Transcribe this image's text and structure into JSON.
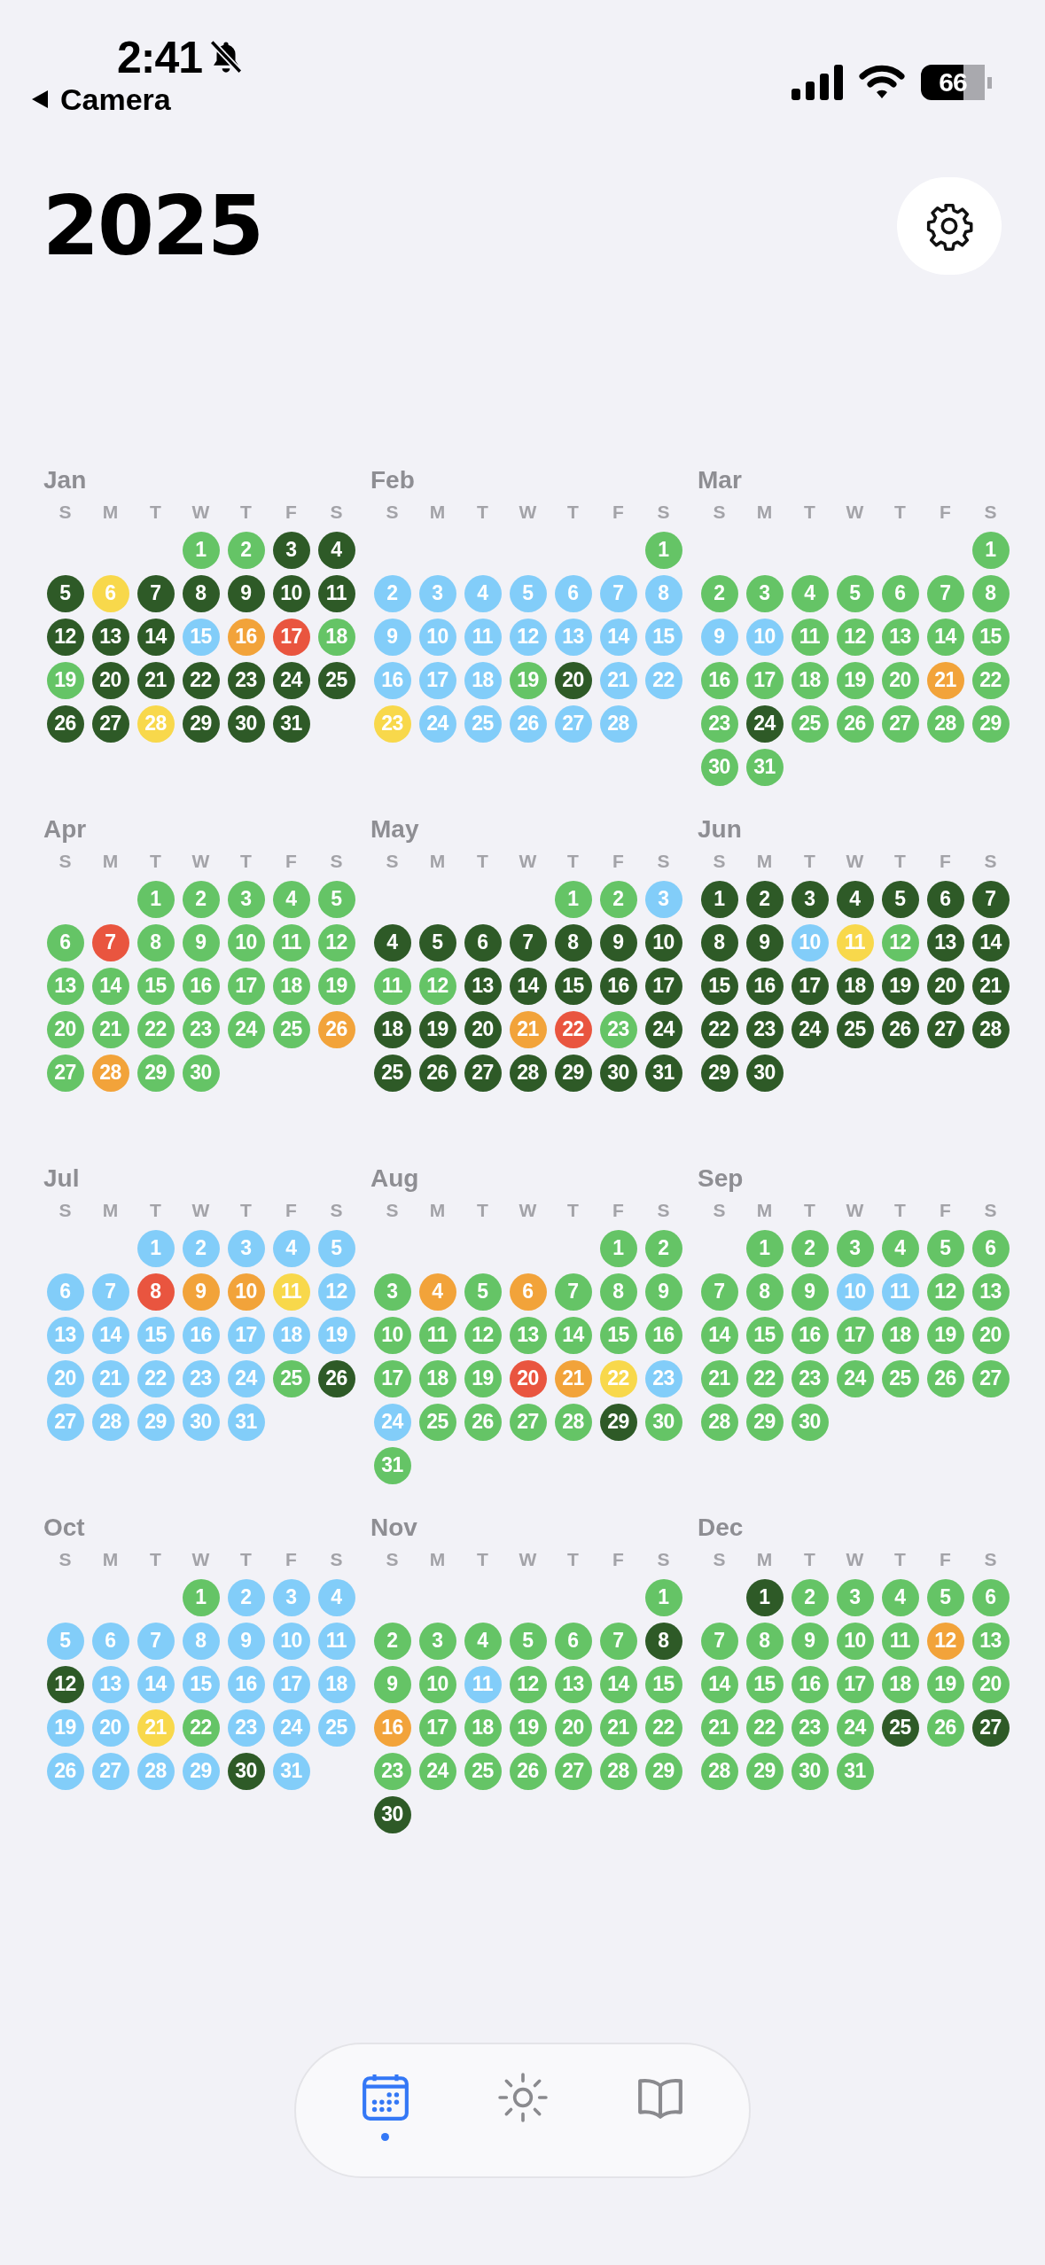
{
  "status_bar": {
    "time": "2:41",
    "back_label": "Camera",
    "battery": "66"
  },
  "title": "2025",
  "months": [
    {
      "name": "Jan",
      "weekdays": [
        "S",
        "M",
        "T",
        "W",
        "T",
        "F",
        "S"
      ],
      "days": [
        {
          "day": "1",
          "color": "#65c466"
        },
        {
          "day": "2",
          "color": "#65c466"
        },
        {
          "day": "3",
          "color": "#2e5a27"
        },
        {
          "day": "4",
          "color": "#2e5a27"
        },
        {
          "day": "5",
          "color": "#2e5a27"
        },
        {
          "day": "6",
          "color": "#f8d84b"
        },
        {
          "day": "7",
          "color": "#2e5a27"
        },
        {
          "day": "8",
          "color": "#2e5a27"
        },
        {
          "day": "9",
          "color": "#2e5a27"
        },
        {
          "day": "10",
          "color": "#2e5a27"
        },
        {
          "day": "11",
          "color": "#2e5a27"
        },
        {
          "day": "12",
          "color": "#2e5a27"
        },
        {
          "day": "13",
          "color": "#2e5a27"
        },
        {
          "day": "14",
          "color": "#2e5a27"
        },
        {
          "day": "15",
          "color": "#82cdf9"
        },
        {
          "day": "16",
          "color": "#f2a33a"
        },
        {
          "day": "17",
          "color": "#e9553f"
        },
        {
          "day": "18",
          "color": "#65c466"
        },
        {
          "day": "19",
          "color": "#65c466"
        },
        {
          "day": "20",
          "color": "#2e5a27"
        },
        {
          "day": "21",
          "color": "#2e5a27"
        },
        {
          "day": "22",
          "color": "#2e5a27"
        },
        {
          "day": "23",
          "color": "#2e5a27"
        },
        {
          "day": "24",
          "color": "#2e5a27"
        },
        {
          "day": "25",
          "color": "#2e5a27"
        },
        {
          "day": "26",
          "color": "#2e5a27"
        },
        {
          "day": "27",
          "color": "#2e5a27"
        },
        {
          "day": "28",
          "color": "#f8d84b"
        },
        {
          "day": "29",
          "color": "#2e5a27"
        },
        {
          "day": "30",
          "color": "#2e5a27"
        },
        {
          "day": "31",
          "color": "#2e5a27"
        }
      ]
    },
    {
      "name": "Feb",
      "weekdays": [
        "S",
        "M",
        "T",
        "W",
        "T",
        "F",
        "S"
      ],
      "days": [
        {
          "day": "1",
          "color": "#65c466"
        },
        {
          "day": "2",
          "color": "#82cdf9"
        },
        {
          "day": "3",
          "color": "#82cdf9"
        },
        {
          "day": "4",
          "color": "#82cdf9"
        },
        {
          "day": "5",
          "color": "#82cdf9"
        },
        {
          "day": "6",
          "color": "#82cdf9"
        },
        {
          "day": "7",
          "color": "#82cdf9"
        },
        {
          "day": "8",
          "color": "#82cdf9"
        },
        {
          "day": "9",
          "color": "#82cdf9"
        },
        {
          "day": "10",
          "color": "#82cdf9"
        },
        {
          "day": "11",
          "color": "#82cdf9"
        },
        {
          "day": "12",
          "color": "#82cdf9"
        },
        {
          "day": "13",
          "color": "#82cdf9"
        },
        {
          "day": "14",
          "color": "#82cdf9"
        },
        {
          "day": "15",
          "color": "#82cdf9"
        },
        {
          "day": "16",
          "color": "#82cdf9"
        },
        {
          "day": "17",
          "color": "#82cdf9"
        },
        {
          "day": "18",
          "color": "#82cdf9"
        },
        {
          "day": "19",
          "color": "#65c466"
        },
        {
          "day": "20",
          "color": "#2e5a27"
        },
        {
          "day": "21",
          "color": "#82cdf9"
        },
        {
          "day": "22",
          "color": "#82cdf9"
        },
        {
          "day": "23",
          "color": "#f8d84b"
        },
        {
          "day": "24",
          "color": "#82cdf9"
        },
        {
          "day": "25",
          "color": "#82cdf9"
        },
        {
          "day": "26",
          "color": "#82cdf9"
        },
        {
          "day": "27",
          "color": "#82cdf9"
        },
        {
          "day": "28",
          "color": "#82cdf9"
        }
      ]
    },
    {
      "name": "Mar",
      "weekdays": [
        "S",
        "M",
        "T",
        "W",
        "T",
        "F",
        "S"
      ],
      "days": [
        {
          "day": "1",
          "color": "#65c466"
        },
        {
          "day": "2",
          "color": "#65c466"
        },
        {
          "day": "3",
          "color": "#65c466"
        },
        {
          "day": "4",
          "color": "#65c466"
        },
        {
          "day": "5",
          "color": "#65c466"
        },
        {
          "day": "6",
          "color": "#65c466"
        },
        {
          "day": "7",
          "color": "#65c466"
        },
        {
          "day": "8",
          "color": "#65c466"
        },
        {
          "day": "9",
          "color": "#82cdf9"
        },
        {
          "day": "10",
          "color": "#82cdf9"
        },
        {
          "day": "11",
          "color": "#65c466"
        },
        {
          "day": "12",
          "color": "#65c466"
        },
        {
          "day": "13",
          "color": "#65c466"
        },
        {
          "day": "14",
          "color": "#65c466"
        },
        {
          "day": "15",
          "color": "#65c466"
        },
        {
          "day": "16",
          "color": "#65c466"
        },
        {
          "day": "17",
          "color": "#65c466"
        },
        {
          "day": "18",
          "color": "#65c466"
        },
        {
          "day": "19",
          "color": "#65c466"
        },
        {
          "day": "20",
          "color": "#65c466"
        },
        {
          "day": "21",
          "color": "#f2a33a"
        },
        {
          "day": "22",
          "color": "#65c466"
        },
        {
          "day": "23",
          "color": "#65c466"
        },
        {
          "day": "24",
          "color": "#2e5a27"
        },
        {
          "day": "25",
          "color": "#65c466"
        },
        {
          "day": "26",
          "color": "#65c466"
        },
        {
          "day": "27",
          "color": "#65c466"
        },
        {
          "day": "28",
          "color": "#65c466"
        },
        {
          "day": "29",
          "color": "#65c466"
        },
        {
          "day": "30",
          "color": "#65c466"
        },
        {
          "day": "31",
          "color": "#65c466"
        }
      ]
    },
    {
      "name": "Apr",
      "weekdays": [
        "S",
        "M",
        "T",
        "W",
        "T",
        "F",
        "S"
      ],
      "days": [
        {
          "day": "1",
          "color": "#65c466"
        },
        {
          "day": "2",
          "color": "#65c466"
        },
        {
          "day": "3",
          "color": "#65c466"
        },
        {
          "day": "4",
          "color": "#65c466"
        },
        {
          "day": "5",
          "color": "#65c466"
        },
        {
          "day": "6",
          "color": "#65c466"
        },
        {
          "day": "7",
          "color": "#e9553f"
        },
        {
          "day": "8",
          "color": "#65c466"
        },
        {
          "day": "9",
          "color": "#65c466"
        },
        {
          "day": "10",
          "color": "#65c466"
        },
        {
          "day": "11",
          "color": "#65c466"
        },
        {
          "day": "12",
          "color": "#65c466"
        },
        {
          "day": "13",
          "color": "#65c466"
        },
        {
          "day": "14",
          "color": "#65c466"
        },
        {
          "day": "15",
          "color": "#65c466"
        },
        {
          "day": "16",
          "color": "#65c466"
        },
        {
          "day": "17",
          "color": "#65c466"
        },
        {
          "day": "18",
          "color": "#65c466"
        },
        {
          "day": "19",
          "color": "#65c466"
        },
        {
          "day": "20",
          "color": "#65c466"
        },
        {
          "day": "21",
          "color": "#65c466"
        },
        {
          "day": "22",
          "color": "#65c466"
        },
        {
          "day": "23",
          "color": "#65c466"
        },
        {
          "day": "24",
          "color": "#65c466"
        },
        {
          "day": "25",
          "color": "#65c466"
        },
        {
          "day": "26",
          "color": "#f2a33a"
        },
        {
          "day": "27",
          "color": "#65c466"
        },
        {
          "day": "28",
          "color": "#f2a33a"
        },
        {
          "day": "29",
          "color": "#65c466"
        },
        {
          "day": "30",
          "color": "#65c466"
        }
      ]
    },
    {
      "name": "May",
      "weekdays": [
        "S",
        "M",
        "T",
        "W",
        "T",
        "F",
        "S"
      ],
      "days": [
        {
          "day": "1",
          "color": "#65c466"
        },
        {
          "day": "2",
          "color": "#65c466"
        },
        {
          "day": "3",
          "color": "#82cdf9"
        },
        {
          "day": "4",
          "color": "#2e5a27"
        },
        {
          "day": "5",
          "color": "#2e5a27"
        },
        {
          "day": "6",
          "color": "#2e5a27"
        },
        {
          "day": "7",
          "color": "#2e5a27"
        },
        {
          "day": "8",
          "color": "#2e5a27"
        },
        {
          "day": "9",
          "color": "#2e5a27"
        },
        {
          "day": "10",
          "color": "#2e5a27"
        },
        {
          "day": "11",
          "color": "#65c466"
        },
        {
          "day": "12",
          "color": "#65c466"
        },
        {
          "day": "13",
          "color": "#2e5a27"
        },
        {
          "day": "14",
          "color": "#2e5a27"
        },
        {
          "day": "15",
          "color": "#2e5a27"
        },
        {
          "day": "16",
          "color": "#2e5a27"
        },
        {
          "day": "17",
          "color": "#2e5a27"
        },
        {
          "day": "18",
          "color": "#2e5a27"
        },
        {
          "day": "19",
          "color": "#2e5a27"
        },
        {
          "day": "20",
          "color": "#2e5a27"
        },
        {
          "day": "21",
          "color": "#f2a33a"
        },
        {
          "day": "22",
          "color": "#e9553f"
        },
        {
          "day": "23",
          "color": "#65c466"
        },
        {
          "day": "24",
          "color": "#2e5a27"
        },
        {
          "day": "25",
          "color": "#2e5a27"
        },
        {
          "day": "26",
          "color": "#2e5a27"
        },
        {
          "day": "27",
          "color": "#2e5a27"
        },
        {
          "day": "28",
          "color": "#2e5a27"
        },
        {
          "day": "29",
          "color": "#2e5a27"
        },
        {
          "day": "30",
          "color": "#2e5a27"
        },
        {
          "day": "31",
          "color": "#2e5a27"
        }
      ]
    },
    {
      "name": "Jun",
      "weekdays": [
        "S",
        "M",
        "T",
        "W",
        "T",
        "F",
        "S"
      ],
      "days": [
        {
          "day": "1",
          "color": "#2e5a27"
        },
        {
          "day": "2",
          "color": "#2e5a27"
        },
        {
          "day": "3",
          "color": "#2e5a27"
        },
        {
          "day": "4",
          "color": "#2e5a27"
        },
        {
          "day": "5",
          "color": "#2e5a27"
        },
        {
          "day": "6",
          "color": "#2e5a27"
        },
        {
          "day": "7",
          "color": "#2e5a27"
        },
        {
          "day": "8",
          "color": "#2e5a27"
        },
        {
          "day": "9",
          "color": "#2e5a27"
        },
        {
          "day": "10",
          "color": "#82cdf9"
        },
        {
          "day": "11",
          "color": "#f8d84b"
        },
        {
          "day": "12",
          "color": "#65c466"
        },
        {
          "day": "13",
          "color": "#2e5a27"
        },
        {
          "day": "14",
          "color": "#2e5a27"
        },
        {
          "day": "15",
          "color": "#2e5a27"
        },
        {
          "day": "16",
          "color": "#2e5a27"
        },
        {
          "day": "17",
          "color": "#2e5a27"
        },
        {
          "day": "18",
          "color": "#2e5a27"
        },
        {
          "day": "19",
          "color": "#2e5a27"
        },
        {
          "day": "20",
          "color": "#2e5a27"
        },
        {
          "day": "21",
          "color": "#2e5a27"
        },
        {
          "day": "22",
          "color": "#2e5a27"
        },
        {
          "day": "23",
          "color": "#2e5a27"
        },
        {
          "day": "24",
          "color": "#2e5a27"
        },
        {
          "day": "25",
          "color": "#2e5a27"
        },
        {
          "day": "26",
          "color": "#2e5a27"
        },
        {
          "day": "27",
          "color": "#2e5a27"
        },
        {
          "day": "28",
          "color": "#2e5a27"
        },
        {
          "day": "29",
          "color": "#2e5a27"
        },
        {
          "day": "30",
          "color": "#2e5a27"
        }
      ]
    },
    {
      "name": "Jul",
      "weekdays": [
        "S",
        "M",
        "T",
        "W",
        "T",
        "F",
        "S"
      ],
      "days": [
        {
          "day": "1",
          "color": "#82cdf9"
        },
        {
          "day": "2",
          "color": "#82cdf9"
        },
        {
          "day": "3",
          "color": "#82cdf9"
        },
        {
          "day": "4",
          "color": "#82cdf9"
        },
        {
          "day": "5",
          "color": "#82cdf9"
        },
        {
          "day": "6",
          "color": "#82cdf9"
        },
        {
          "day": "7",
          "color": "#82cdf9"
        },
        {
          "day": "8",
          "color": "#e9553f"
        },
        {
          "day": "9",
          "color": "#f2a33a"
        },
        {
          "day": "10",
          "color": "#f2a33a"
        },
        {
          "day": "11",
          "color": "#f8d84b"
        },
        {
          "day": "12",
          "color": "#82cdf9"
        },
        {
          "day": "13",
          "color": "#82cdf9"
        },
        {
          "day": "14",
          "color": "#82cdf9"
        },
        {
          "day": "15",
          "color": "#82cdf9"
        },
        {
          "day": "16",
          "color": "#82cdf9"
        },
        {
          "day": "17",
          "color": "#82cdf9"
        },
        {
          "day": "18",
          "color": "#82cdf9"
        },
        {
          "day": "19",
          "color": "#82cdf9"
        },
        {
          "day": "20",
          "color": "#82cdf9"
        },
        {
          "day": "21",
          "color": "#82cdf9"
        },
        {
          "day": "22",
          "color": "#82cdf9"
        },
        {
          "day": "23",
          "color": "#82cdf9"
        },
        {
          "day": "24",
          "color": "#82cdf9"
        },
        {
          "day": "25",
          "color": "#65c466"
        },
        {
          "day": "26",
          "color": "#2e5a27"
        },
        {
          "day": "27",
          "color": "#82cdf9"
        },
        {
          "day": "28",
          "color": "#82cdf9"
        },
        {
          "day": "29",
          "color": "#82cdf9"
        },
        {
          "day": "30",
          "color": "#82cdf9"
        },
        {
          "day": "31",
          "color": "#82cdf9"
        }
      ]
    },
    {
      "name": "Aug",
      "weekdays": [
        "S",
        "M",
        "T",
        "W",
        "T",
        "F",
        "S"
      ],
      "days": [
        {
          "day": "1",
          "color": "#65c466"
        },
        {
          "day": "2",
          "color": "#65c466"
        },
        {
          "day": "3",
          "color": "#65c466"
        },
        {
          "day": "4",
          "color": "#f2a33a"
        },
        {
          "day": "5",
          "color": "#65c466"
        },
        {
          "day": "6",
          "color": "#f2a33a"
        },
        {
          "day": "7",
          "color": "#65c466"
        },
        {
          "day": "8",
          "color": "#65c466"
        },
        {
          "day": "9",
          "color": "#65c466"
        },
        {
          "day": "10",
          "color": "#65c466"
        },
        {
          "day": "11",
          "color": "#65c466"
        },
        {
          "day": "12",
          "color": "#65c466"
        },
        {
          "day": "13",
          "color": "#65c466"
        },
        {
          "day": "14",
          "color": "#65c466"
        },
        {
          "day": "15",
          "color": "#65c466"
        },
        {
          "day": "16",
          "color": "#65c466"
        },
        {
          "day": "17",
          "color": "#65c466"
        },
        {
          "day": "18",
          "color": "#65c466"
        },
        {
          "day": "19",
          "color": "#65c466"
        },
        {
          "day": "20",
          "color": "#e9553f"
        },
        {
          "day": "21",
          "color": "#f2a33a"
        },
        {
          "day": "22",
          "color": "#f8d84b"
        },
        {
          "day": "23",
          "color": "#82cdf9"
        },
        {
          "day": "24",
          "color": "#82cdf9"
        },
        {
          "day": "25",
          "color": "#65c466"
        },
        {
          "day": "26",
          "color": "#65c466"
        },
        {
          "day": "27",
          "color": "#65c466"
        },
        {
          "day": "28",
          "color": "#65c466"
        },
        {
          "day": "29",
          "color": "#2e5a27"
        },
        {
          "day": "30",
          "color": "#65c466"
        },
        {
          "day": "31",
          "color": "#65c466"
        }
      ]
    },
    {
      "name": "Sep",
      "weekdays": [
        "S",
        "M",
        "T",
        "W",
        "T",
        "F",
        "S"
      ],
      "days": [
        {
          "day": "1",
          "color": "#65c466"
        },
        {
          "day": "2",
          "color": "#65c466"
        },
        {
          "day": "3",
          "color": "#65c466"
        },
        {
          "day": "4",
          "color": "#65c466"
        },
        {
          "day": "5",
          "color": "#65c466"
        },
        {
          "day": "6",
          "color": "#65c466"
        },
        {
          "day": "7",
          "color": "#65c466"
        },
        {
          "day": "8",
          "color": "#65c466"
        },
        {
          "day": "9",
          "color": "#65c466"
        },
        {
          "day": "10",
          "color": "#82cdf9"
        },
        {
          "day": "11",
          "color": "#82cdf9"
        },
        {
          "day": "12",
          "color": "#65c466"
        },
        {
          "day": "13",
          "color": "#65c466"
        },
        {
          "day": "14",
          "color": "#65c466"
        },
        {
          "day": "15",
          "color": "#65c466"
        },
        {
          "day": "16",
          "color": "#65c466"
        },
        {
          "day": "17",
          "color": "#65c466"
        },
        {
          "day": "18",
          "color": "#65c466"
        },
        {
          "day": "19",
          "color": "#65c466"
        },
        {
          "day": "20",
          "color": "#65c466"
        },
        {
          "day": "21",
          "color": "#65c466"
        },
        {
          "day": "22",
          "color": "#65c466"
        },
        {
          "day": "23",
          "color": "#65c466"
        },
        {
          "day": "24",
          "color": "#65c466"
        },
        {
          "day": "25",
          "color": "#65c466"
        },
        {
          "day": "26",
          "color": "#65c466"
        },
        {
          "day": "27",
          "color": "#65c466"
        },
        {
          "day": "28",
          "color": "#65c466"
        },
        {
          "day": "29",
          "color": "#65c466"
        },
        {
          "day": "30",
          "color": "#65c466"
        }
      ]
    },
    {
      "name": "Oct",
      "weekdays": [
        "S",
        "M",
        "T",
        "W",
        "T",
        "F",
        "S"
      ],
      "days": [
        {
          "day": "1",
          "color": "#65c466"
        },
        {
          "day": "2",
          "color": "#82cdf9"
        },
        {
          "day": "3",
          "color": "#82cdf9"
        },
        {
          "day": "4",
          "color": "#82cdf9"
        },
        {
          "day": "5",
          "color": "#82cdf9"
        },
        {
          "day": "6",
          "color": "#82cdf9"
        },
        {
          "day": "7",
          "color": "#82cdf9"
        },
        {
          "day": "8",
          "color": "#82cdf9"
        },
        {
          "day": "9",
          "color": "#82cdf9"
        },
        {
          "day": "10",
          "color": "#82cdf9"
        },
        {
          "day": "11",
          "color": "#82cdf9"
        },
        {
          "day": "12",
          "color": "#2e5a27"
        },
        {
          "day": "13",
          "color": "#82cdf9"
        },
        {
          "day": "14",
          "color": "#82cdf9"
        },
        {
          "day": "15",
          "color": "#82cdf9"
        },
        {
          "day": "16",
          "color": "#82cdf9"
        },
        {
          "day": "17",
          "color": "#82cdf9"
        },
        {
          "day": "18",
          "color": "#82cdf9"
        },
        {
          "day": "19",
          "color": "#82cdf9"
        },
        {
          "day": "20",
          "color": "#82cdf9"
        },
        {
          "day": "21",
          "color": "#f8d84b"
        },
        {
          "day": "22",
          "color": "#65c466"
        },
        {
          "day": "23",
          "color": "#82cdf9"
        },
        {
          "day": "24",
          "color": "#82cdf9"
        },
        {
          "day": "25",
          "color": "#82cdf9"
        },
        {
          "day": "26",
          "color": "#82cdf9"
        },
        {
          "day": "27",
          "color": "#82cdf9"
        },
        {
          "day": "28",
          "color": "#82cdf9"
        },
        {
          "day": "29",
          "color": "#82cdf9"
        },
        {
          "day": "30",
          "color": "#2e5a27"
        },
        {
          "day": "31",
          "color": "#82cdf9"
        }
      ]
    },
    {
      "name": "Nov",
      "weekdays": [
        "S",
        "M",
        "T",
        "W",
        "T",
        "F",
        "S"
      ],
      "days": [
        {
          "day": "1",
          "color": "#65c466"
        },
        {
          "day": "2",
          "color": "#65c466"
        },
        {
          "day": "3",
          "color": "#65c466"
        },
        {
          "day": "4",
          "color": "#65c466"
        },
        {
          "day": "5",
          "color": "#65c466"
        },
        {
          "day": "6",
          "color": "#65c466"
        },
        {
          "day": "7",
          "color": "#65c466"
        },
        {
          "day": "8",
          "color": "#2e5a27"
        },
        {
          "day": "9",
          "color": "#65c466"
        },
        {
          "day": "10",
          "color": "#65c466"
        },
        {
          "day": "11",
          "color": "#82cdf9"
        },
        {
          "day": "12",
          "color": "#65c466"
        },
        {
          "day": "13",
          "color": "#65c466"
        },
        {
          "day": "14",
          "color": "#65c466"
        },
        {
          "day": "15",
          "color": "#65c466"
        },
        {
          "day": "16",
          "color": "#f2a33a"
        },
        {
          "day": "17",
          "color": "#65c466"
        },
        {
          "day": "18",
          "color": "#65c466"
        },
        {
          "day": "19",
          "color": "#65c466"
        },
        {
          "day": "20",
          "color": "#65c466"
        },
        {
          "day": "21",
          "color": "#65c466"
        },
        {
          "day": "22",
          "color": "#65c466"
        },
        {
          "day": "23",
          "color": "#65c466"
        },
        {
          "day": "24",
          "color": "#65c466"
        },
        {
          "day": "25",
          "color": "#65c466"
        },
        {
          "day": "26",
          "color": "#65c466"
        },
        {
          "day": "27",
          "color": "#65c466"
        },
        {
          "day": "28",
          "color": "#65c466"
        },
        {
          "day": "29",
          "color": "#65c466"
        },
        {
          "day": "30",
          "color": "#2e5a27"
        }
      ]
    },
    {
      "name": "Dec",
      "weekdays": [
        "S",
        "M",
        "T",
        "W",
        "T",
        "F",
        "S"
      ],
      "days": [
        {
          "day": "1",
          "color": "#2e5a27"
        },
        {
          "day": "2",
          "color": "#65c466"
        },
        {
          "day": "3",
          "color": "#65c466"
        },
        {
          "day": "4",
          "color": "#65c466"
        },
        {
          "day": "5",
          "color": "#65c466"
        },
        {
          "day": "6",
          "color": "#65c466"
        },
        {
          "day": "7",
          "color": "#65c466"
        },
        {
          "day": "8",
          "color": "#65c466"
        },
        {
          "day": "9",
          "color": "#65c466"
        },
        {
          "day": "10",
          "color": "#65c466"
        },
        {
          "day": "11",
          "color": "#65c466"
        },
        {
          "day": "12",
          "color": "#f2a33a"
        },
        {
          "day": "13",
          "color": "#65c466"
        },
        {
          "day": "14",
          "color": "#65c466"
        },
        {
          "day": "15",
          "color": "#65c466"
        },
        {
          "day": "16",
          "color": "#65c466"
        },
        {
          "day": "17",
          "color": "#65c466"
        },
        {
          "day": "18",
          "color": "#65c466"
        },
        {
          "day": "19",
          "color": "#65c466"
        },
        {
          "day": "20",
          "color": "#65c466"
        },
        {
          "day": "21",
          "color": "#65c466"
        },
        {
          "day": "22",
          "color": "#65c466"
        },
        {
          "day": "23",
          "color": "#65c466"
        },
        {
          "day": "24",
          "color": "#65c466"
        },
        {
          "day": "25",
          "color": "#2e5a27"
        },
        {
          "day": "26",
          "color": "#65c466"
        },
        {
          "day": "27",
          "color": "#2e5a27"
        },
        {
          "day": "28",
          "color": "#65c466"
        },
        {
          "day": "29",
          "color": "#65c466"
        },
        {
          "day": "30",
          "color": "#65c466"
        },
        {
          "day": "31",
          "color": "#65c466"
        }
      ]
    }
  ],
  "tabs": [
    {
      "kind": "calendar",
      "selected": true
    },
    {
      "kind": "sun",
      "selected": false
    },
    {
      "kind": "book",
      "selected": false
    }
  ]
}
